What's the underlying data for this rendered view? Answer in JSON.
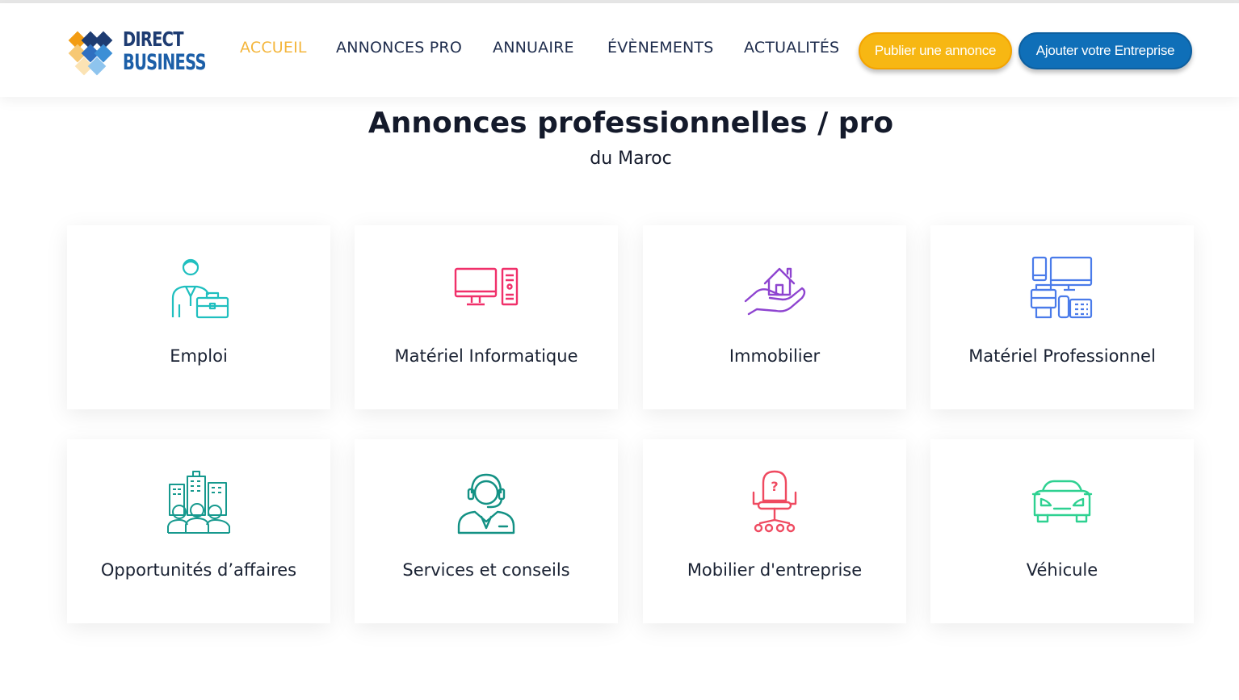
{
  "brand": {
    "line1": "DIRECT",
    "line2": "BUSINESS"
  },
  "nav": {
    "items": [
      {
        "label": "ACCUEIL",
        "active": true
      },
      {
        "label": "ANNONCES PRO",
        "active": false
      },
      {
        "label": "ANNUAIRE",
        "active": false
      },
      {
        "label": "ÉVÈNEMENTS",
        "active": false
      },
      {
        "label": "ACTUALITÉS",
        "active": false
      }
    ]
  },
  "actions": {
    "publish_label": "Publier une annonce",
    "add_company_label": "Ajouter votre Entreprise"
  },
  "page": {
    "title": "Annonces professionnelles / pro",
    "subtitle": "du Maroc"
  },
  "categories": [
    {
      "label": "Emploi",
      "icon": "employee-briefcase-icon",
      "color": "#1fbfbf"
    },
    {
      "label": "Matériel Informatique",
      "icon": "desktop-computer-icon",
      "color": "#f0306a"
    },
    {
      "label": "Immobilier",
      "icon": "house-in-hand-icon",
      "color": "#8e44d0"
    },
    {
      "label": "Matériel Professionnel",
      "icon": "office-devices-icon",
      "color": "#4a7bea"
    },
    {
      "label": "Opportunités d’affaires",
      "icon": "business-people-buildings-icon",
      "color": "#16998e"
    },
    {
      "label": "Services et conseils",
      "icon": "support-agent-headset-icon",
      "color": "#139184"
    },
    {
      "label": "Mobilier d'entreprise",
      "icon": "office-chair-icon",
      "color": "#ef4a60"
    },
    {
      "label": "Véhicule",
      "icon": "car-icon",
      "color": "#2ed191"
    }
  ],
  "colors": {
    "accent_yellow": "#f7b713",
    "accent_blue": "#0f6fb8",
    "nav_text": "#1f2d4d",
    "nav_active": "#f4b63c"
  }
}
